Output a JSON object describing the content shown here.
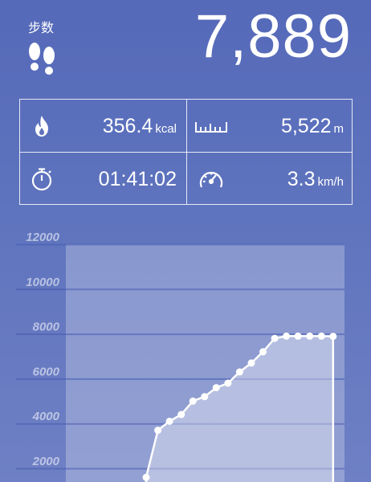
{
  "header": {
    "steps_label": "步数",
    "step_count": "7,889"
  },
  "stats": {
    "calories": {
      "value": "356.4",
      "unit": "kcal",
      "icon": "flame-icon"
    },
    "distance": {
      "value": "5,522",
      "unit": "m",
      "icon": "ruler-icon"
    },
    "duration": {
      "value": "01:41:02",
      "icon": "stopwatch-icon"
    },
    "speed": {
      "value": "3.3",
      "unit": "km/h",
      "icon": "speedometer-icon"
    }
  },
  "chart_data": {
    "type": "area",
    "y_ticks": [
      "12000",
      "10000",
      "8000",
      "6000",
      "4000",
      "2000"
    ],
    "ylim": [
      0,
      12000
    ],
    "x": [
      0,
      1,
      2,
      3,
      4,
      5,
      6,
      7,
      8,
      9,
      10,
      11,
      12,
      13,
      14,
      15,
      16,
      17,
      18,
      19,
      20,
      21,
      22,
      23
    ],
    "values": [
      0,
      0,
      0,
      0,
      0,
      0,
      0,
      1600,
      3700,
      4100,
      4400,
      5000,
      5200,
      5600,
      5800,
      6300,
      6700,
      7200,
      7800,
      7900,
      7900,
      7900,
      7900,
      7889
    ],
    "grid": true,
    "colors": {
      "line": "#ffffff",
      "fill": "rgba(255,255,255,0.35)",
      "plot_bg": "rgba(255,255,255,0.25)"
    }
  }
}
